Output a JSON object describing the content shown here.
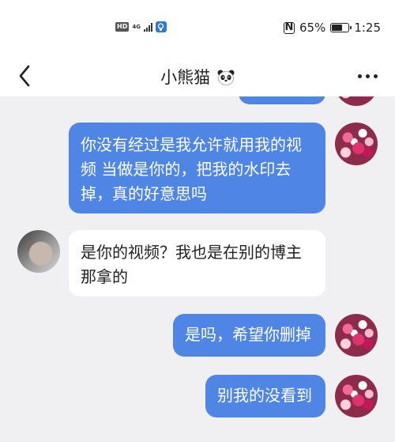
{
  "status_bar": {
    "hd": "HD",
    "network": "4G",
    "battery_percent": "65%",
    "battery_level": 0.65,
    "time": "1:25"
  },
  "nav": {
    "title": "小熊猫"
  },
  "messages": [
    {
      "direction": "sent",
      "text": ""
    },
    {
      "direction": "sent",
      "lines": [
        "你没有经过是我允许就用我的视",
        "频 当做是你的，把我的水印去",
        "掉，真的好意思吗"
      ]
    },
    {
      "direction": "received",
      "lines": [
        "是你的视频？我也是在别的博主",
        "那拿的"
      ]
    },
    {
      "direction": "sent",
      "lines": [
        "是吗，希望你删掉"
      ]
    },
    {
      "direction": "sent",
      "lines": [
        "别我的没看到"
      ]
    }
  ],
  "colors": {
    "sent_bubble": "#4f86e6",
    "received_bubble": "#ffffff",
    "chat_background": "#f0f0f2"
  }
}
